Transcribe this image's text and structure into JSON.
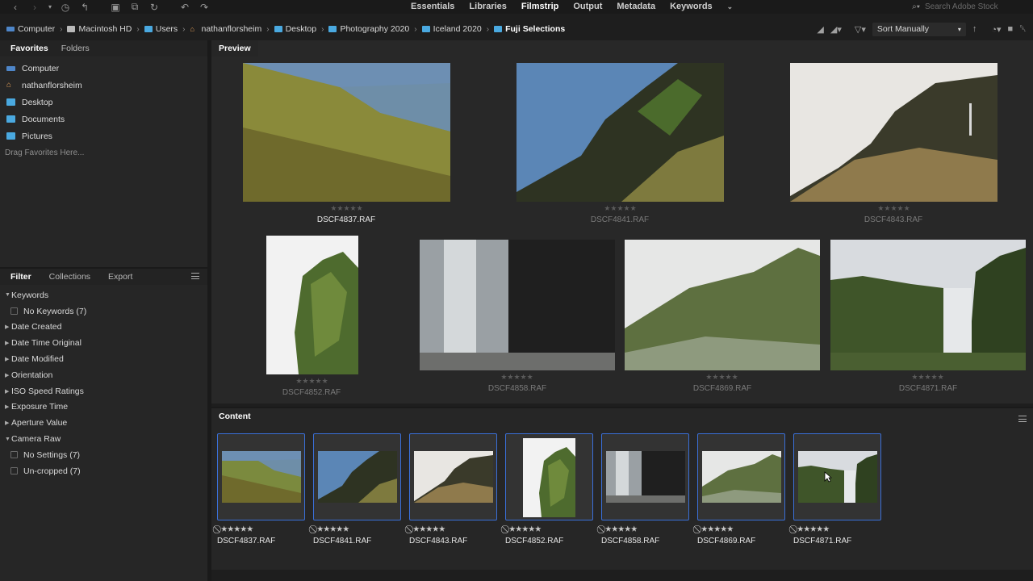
{
  "workspaces": [
    "Essentials",
    "Libraries",
    "Filmstrip",
    "Output",
    "Metadata",
    "Keywords"
  ],
  "active_workspace": "Filmstrip",
  "search": {
    "placeholder": "Search Adobe Stock"
  },
  "breadcrumbs": [
    "Computer",
    "Macintosh HD",
    "Users",
    "nathanflorsheim",
    "Desktop",
    "Photography 2020",
    "Iceland 2020",
    "Fuji Selections"
  ],
  "sort": {
    "label": "Sort Manually"
  },
  "left_tabs": {
    "favorites": "Favorites",
    "folders": "Folders"
  },
  "favorites": [
    "Computer",
    "nathanflorsheim",
    "Desktop",
    "Documents",
    "Pictures"
  ],
  "drag_hint": "Drag Favorites Here...",
  "filter_tabs": {
    "filter": "Filter",
    "collections": "Collections",
    "export": "Export"
  },
  "filter_rows": [
    {
      "label": "Keywords",
      "expanded": true
    },
    {
      "label": "No Keywords",
      "count": "(7)",
      "child": true
    },
    {
      "label": "Date Created"
    },
    {
      "label": "Date Time Original"
    },
    {
      "label": "Date Modified"
    },
    {
      "label": "Orientation"
    },
    {
      "label": "ISO Speed Ratings"
    },
    {
      "label": "Exposure Time"
    },
    {
      "label": "Aperture Value"
    },
    {
      "label": "Camera Raw",
      "expanded": true
    },
    {
      "label": "No Settings",
      "count": "(7)",
      "child": true
    },
    {
      "label": "Un-cropped",
      "count": "(7)",
      "child": true
    }
  ],
  "preview": {
    "title": "Preview",
    "stars": "★★★★★"
  },
  "content": {
    "title": "Content",
    "rating": "⃠ ★★★★★"
  },
  "files": [
    "DSCF4837.RAF",
    "DSCF4841.RAF",
    "DSCF4843.RAF",
    "DSCF4852.RAF",
    "DSCF4858.RAF",
    "DSCF4869.RAF",
    "DSCF4871.RAF"
  ],
  "icons": {
    "back": "chevron-left-icon",
    "forward": "chevron-right-icon",
    "recent": "clock-icon",
    "boomerang": "return-icon",
    "camera": "camera-icon",
    "copy": "copy-icon",
    "refresh": "refresh-icon",
    "rotate_left": "rotate-left-icon",
    "rotate_right": "rotate-right-icon",
    "search": "search-icon"
  }
}
